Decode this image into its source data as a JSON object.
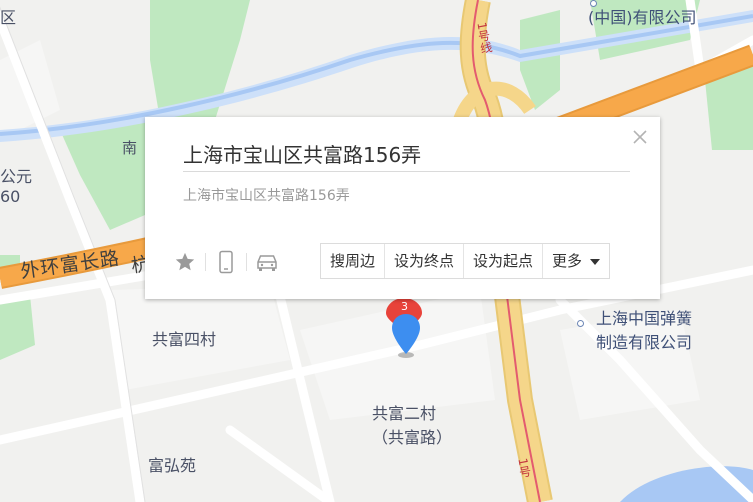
{
  "map": {
    "labels": {
      "company_top": "(中国)有限公司",
      "district_left": "区",
      "park_left_1": "公元",
      "park_left_2": "60",
      "road_south": "南",
      "road_outer_ring": "外环富长路",
      "road_outer_ring_tail": "杭",
      "village_gongfu4": "共富四村",
      "village_gongfu2_line1": "共富二村",
      "village_gongfu2_line2": "（共富路）",
      "fuhongyuan": "富弘苑",
      "spring_company_line1": "上海中国弹簧",
      "spring_company_line2": "制造有限公司",
      "metro_line_top": "1号线",
      "metro_line_bottom": "1号"
    },
    "marker_badge": "3",
    "colors": {
      "background": "#f1f1ef",
      "green_space": "#bfe8c0",
      "water": "#a8c8f4",
      "highway": "#f7a84a",
      "metro_road": "#f5d68a",
      "metro_line": "#e35b6f",
      "marker_blue": "#3d8ef0",
      "marker_red": "#e8433a"
    }
  },
  "popup": {
    "title": "上海市宝山区共富路156弄",
    "subtitle": "上海市宝山区共富路156弄",
    "icons": [
      "star-icon",
      "phone-icon",
      "car-icon",
      "close-icon"
    ],
    "actions": {
      "nearby": "搜周边",
      "set_end": "设为终点",
      "set_start": "设为起点",
      "more": "更多"
    }
  }
}
